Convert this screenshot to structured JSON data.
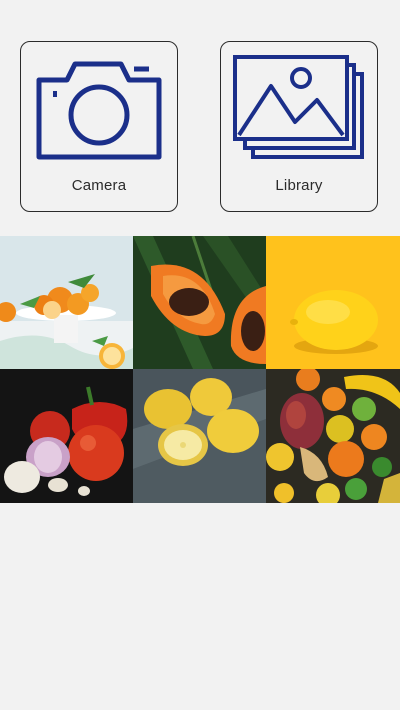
{
  "actions": {
    "camera": {
      "label": "Camera",
      "icon": "camera-icon"
    },
    "library": {
      "label": "Library",
      "icon": "gallery-icon"
    }
  },
  "gallery": {
    "photos": [
      {
        "subject": "oranges-on-cake-stand"
      },
      {
        "subject": "papaya-halves"
      },
      {
        "subject": "lemon-yellow-background"
      },
      {
        "subject": "tomatoes-onion-garlic"
      },
      {
        "subject": "lemons-on-wood"
      },
      {
        "subject": "mixed-fruit-assortment"
      }
    ]
  },
  "colors": {
    "icon": "#1b2f8a",
    "background": "#f2f2f2"
  }
}
